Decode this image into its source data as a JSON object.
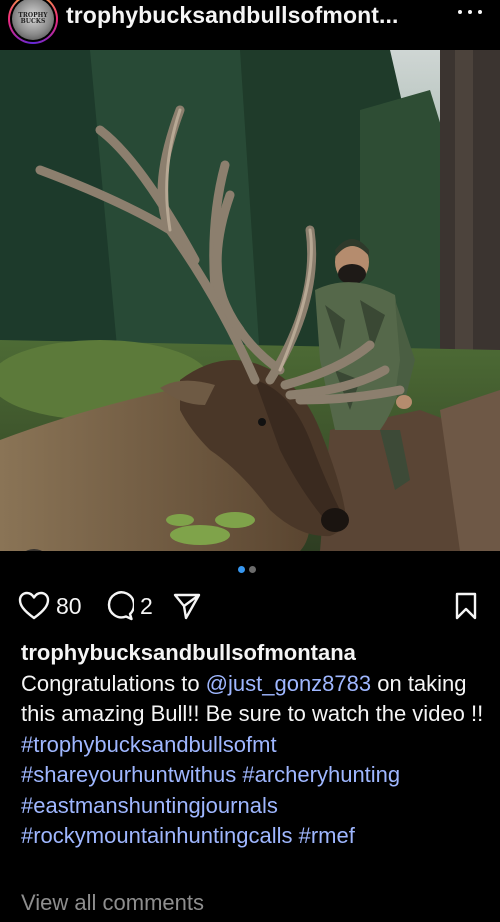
{
  "post": {
    "header_username": "trophybucksandbullsofmont...",
    "avatar_text": "TROPHY BUCKS",
    "likes_count": "80",
    "comments_count": "2",
    "carousel_dots": 2,
    "caption_username": "trophybucksandbullsofmontana",
    "caption_prefix": "Congratulations to ",
    "caption_mention": "@just_gonz8783",
    "caption_suffix": " on taking this amazing Bull!! Be sure to watch the video !!",
    "hashtags": [
      "#trophybucksandbullsofmt",
      "#shareyourhuntwithus",
      "#archeryhunting",
      "#eastmanshuntingjournals",
      "#rockymountainhuntingcalls",
      "#rmef"
    ],
    "view_comments": "View all comments"
  },
  "icons": {
    "more": "more-dots-icon",
    "like": "heart-icon",
    "comment": "comment-bubble-icon",
    "share": "paper-plane-icon",
    "save": "bookmark-icon",
    "tag": "person-tag-icon"
  },
  "colors": {
    "background": "#000000",
    "text": "#f5f5f5",
    "link": "#9fb7ff",
    "muted": "#8e8e8e",
    "active_dot": "#3797f0",
    "inactive_dot": "#6b6b6b"
  }
}
